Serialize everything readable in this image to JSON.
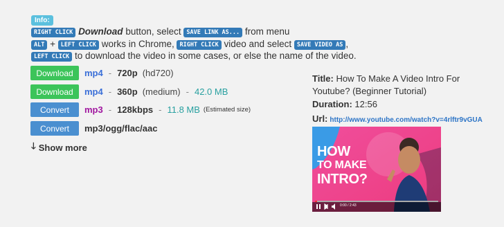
{
  "info_badge": "Info:",
  "instructions": {
    "line1": {
      "key1": "RIGHT CLICK",
      "download_word": "Download",
      "text1": " button, select ",
      "key2": "SAVE LINK AS...",
      "text2": " from menu"
    },
    "line2": {
      "key1": "ALT",
      "plus": " + ",
      "key2": "LEFT CLICK",
      "text1": " works in Chrome, ",
      "key3": "RIGHT CLICK",
      "text2": " video and select ",
      "key4": "SAVE VIDEO AS",
      "text3": ","
    },
    "line3": {
      "key1": "LEFT CLICK",
      "text1": " to download the video in some cases, or else the name of the video."
    }
  },
  "downloads": [
    {
      "button": "Download",
      "format": "mp4",
      "sep1": "-",
      "quality": "720p",
      "tag": "(hd720)"
    },
    {
      "button": "Download",
      "format": "mp4",
      "sep1": "-",
      "quality": "360p",
      "tag": "(medium)",
      "sep2": "-",
      "size": "42.0 MB"
    },
    {
      "button": "Convert",
      "format": "mp3",
      "sep1": "-",
      "quality": "128kbps",
      "sep2": "-",
      "size": "11.8 MB",
      "note": "(Estimated size)"
    },
    {
      "button": "Convert",
      "format": "mp3/ogg/flac/aac"
    }
  ],
  "show_more": "Show more",
  "video": {
    "title_label": "Title:",
    "title": "How To Make A Video Intro For Youtube? (Beginner Tutorial)",
    "duration_label": "Duration:",
    "duration": "12:56",
    "url_label": "Url:",
    "url": "http://www.youtube.com/watch?v=4rlftr9vGUA",
    "thumbnail_text": [
      "HOW",
      "TO MAKE",
      "INTRO?"
    ],
    "player_time": "0:00 / 2:43"
  },
  "colors": {
    "download_green": "#3cc45a",
    "convert_blue": "#4a8fd0",
    "kbd_blue": "#337ab7",
    "info_cyan": "#5bc0de",
    "mp4_blue": "#3a6fd8",
    "mp3_purple": "#a0179f",
    "size_teal": "#28a0a0",
    "thumbnail_pink": "#f25b9d"
  }
}
